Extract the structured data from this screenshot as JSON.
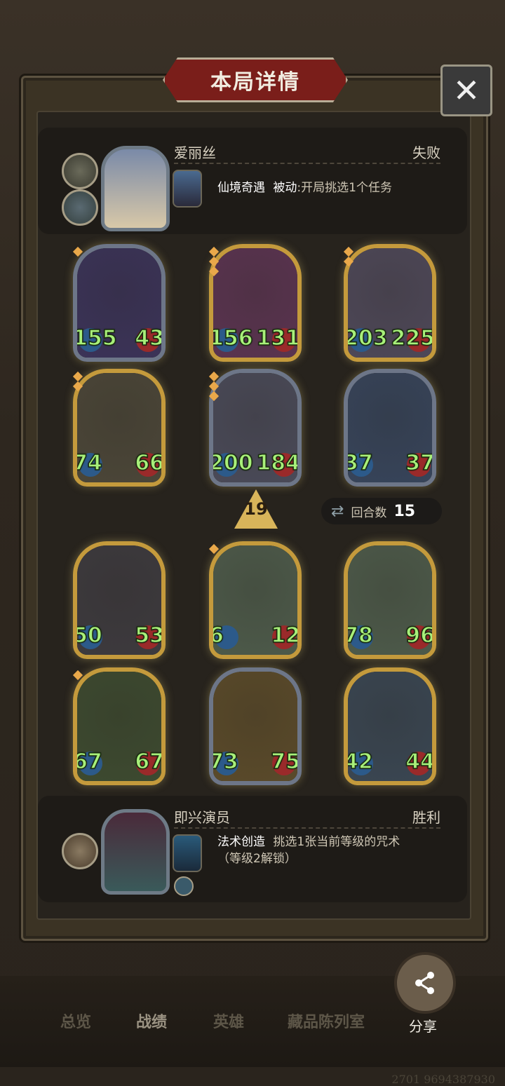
{
  "title": "本局详情",
  "close_label": "✕",
  "top_player": {
    "name": "爱丽丝",
    "result": "失败",
    "skill_name": "仙境奇遇",
    "skill_type": "被动",
    "skill_desc": ":开局挑选1个任务"
  },
  "board_top": [
    {
      "atk": "155",
      "hp": "43",
      "style": "blue",
      "art": "#3b3358",
      "pips": 1
    },
    {
      "atk": "156",
      "hp": "131",
      "style": "gold",
      "art": "#5a3450",
      "pips": 3
    },
    {
      "atk": "203",
      "hp": "225",
      "style": "gold",
      "art": "#4e4858",
      "pips": 2
    },
    {
      "atk": "74",
      "hp": "66",
      "style": "gold",
      "art": "#4b4638",
      "pips": 2
    },
    {
      "atk": "200",
      "hp": "184",
      "style": "blue",
      "art": "#4a4a58",
      "pips": 3
    },
    {
      "atk": "37",
      "hp": "37",
      "style": "blue",
      "art": "#37445a",
      "pips": 0
    }
  ],
  "level": "19",
  "turns_label": "回合数",
  "turns_value": "15",
  "board_bottom": [
    {
      "atk": "50",
      "hp": "53",
      "style": "gold",
      "art": "#3d3a3e",
      "pips": 0
    },
    {
      "atk": "6",
      "hp": "12",
      "style": "gold",
      "art": "#4d5a4a",
      "pips": 1
    },
    {
      "atk": "78",
      "hp": "96",
      "style": "gold",
      "art": "#4d5a4a",
      "pips": 0
    },
    {
      "atk": "67",
      "hp": "67",
      "style": "gold",
      "art": "#3d4a30",
      "pips": 1
    },
    {
      "atk": "73",
      "hp": "75",
      "style": "blue",
      "art": "#5a4a2a",
      "pips": 0
    },
    {
      "atk": "42",
      "hp": "44",
      "style": "gold",
      "art": "#3a4652",
      "pips": 0
    }
  ],
  "bottom_player": {
    "name": "即兴演员",
    "result": "胜利",
    "skill_name": "法术创造",
    "skill_desc": "挑选1张当前等级的咒术",
    "skill_note": "（等级2解锁）"
  },
  "tabs": [
    "总览",
    "战绩",
    "英雄",
    "藏品陈列室"
  ],
  "share_label": "分享",
  "uid": "2701 9694387930",
  "colors": {
    "stat": "#a8f07a",
    "title_plate": "#7a1e1a",
    "gold_frame": "#c49a3c",
    "blue_frame": "#6d7688"
  }
}
